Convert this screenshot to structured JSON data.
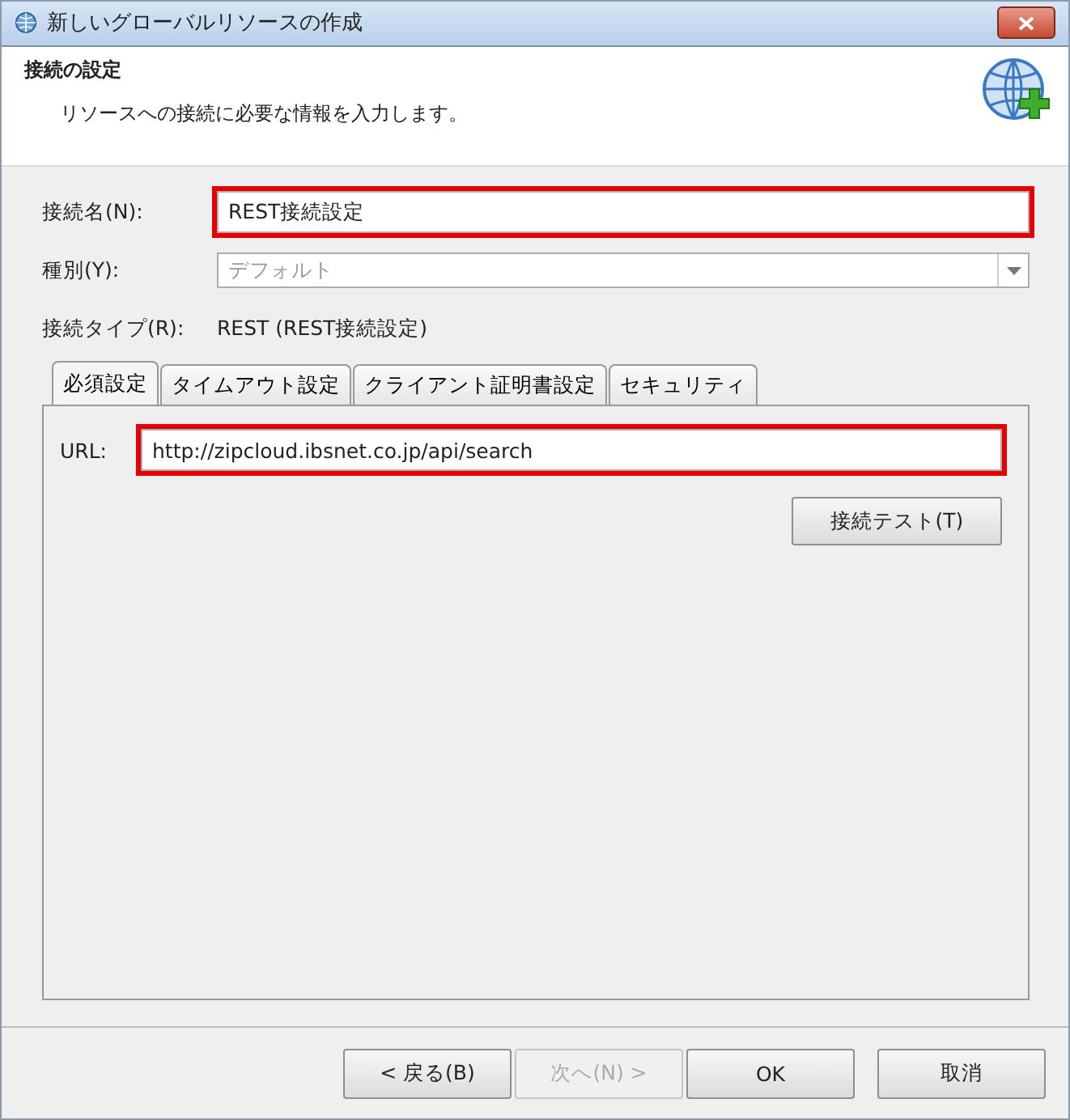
{
  "window": {
    "title": "新しいグローバルリソースの作成"
  },
  "header": {
    "title": "接続の設定",
    "description": "リソースへの接続に必要な情報を入力します。"
  },
  "fields": [
    {
      "kind": "text",
      "label": "接続名(N):",
      "value": "REST接続設定",
      "highlighted": true,
      "disabled": false
    },
    {
      "kind": "combo",
      "label": "種別(Y):",
      "value": "デフォルト",
      "highlighted": false,
      "disabled": true
    },
    {
      "kind": "static",
      "label": "接続タイプ(R):",
      "value": "REST (REST接続設定)"
    }
  ],
  "tabs": [
    {
      "label": "必須設定",
      "selected": true
    },
    {
      "label": "タイムアウト設定",
      "selected": false
    },
    {
      "label": "クライアント証明書設定",
      "selected": false
    },
    {
      "label": "セキュリティ",
      "selected": false
    }
  ],
  "panel": {
    "url_label": "URL:",
    "url_value": "http://zipcloud.ibsnet.co.jp/api/search",
    "url_highlighted": true,
    "test_button": "接続テスト(T)"
  },
  "buttons": [
    {
      "label": "< 戻る(B)",
      "disabled": false
    },
    {
      "label": "次へ(N) >",
      "disabled": true
    },
    {
      "label": "OK",
      "disabled": false
    },
    {
      "label": "取消",
      "disabled": false
    }
  ]
}
